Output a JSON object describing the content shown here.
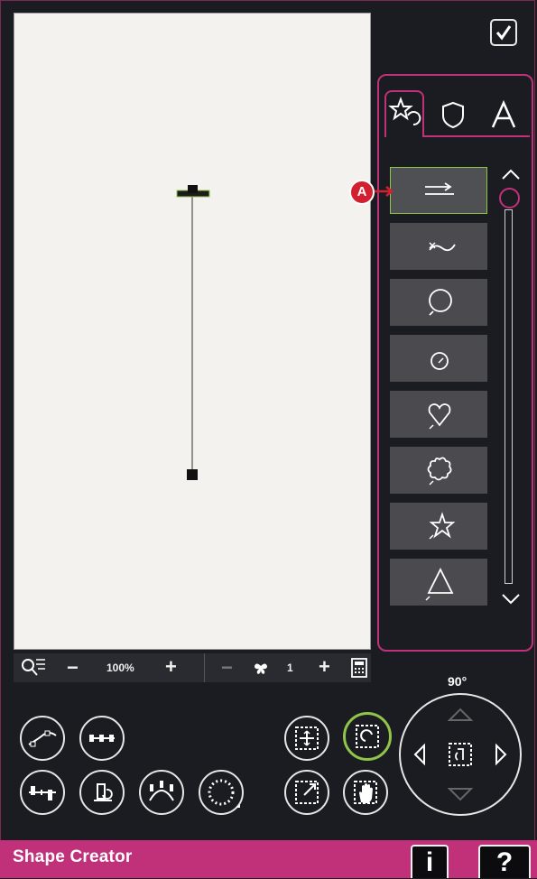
{
  "app_title": "Shape Creator",
  "confirm": {
    "icon": "checkmark-icon"
  },
  "tabs": [
    {
      "name": "shapes",
      "icon": "star-shapes-icon",
      "selected": true
    },
    {
      "name": "outline",
      "icon": "shield-icon",
      "selected": false
    },
    {
      "name": "text",
      "icon": "letter-a-icon",
      "label": "A",
      "selected": false
    }
  ],
  "shape_list": [
    {
      "icon": "straight-line-icon",
      "selected": true
    },
    {
      "icon": "wave-line-icon",
      "selected": false
    },
    {
      "icon": "circle-shape-icon",
      "selected": false
    },
    {
      "icon": "small-circle-shape-icon",
      "selected": false
    },
    {
      "icon": "heart-shape-icon",
      "selected": false
    },
    {
      "icon": "flower-shape-icon",
      "selected": false
    },
    {
      "icon": "star-shape-icon",
      "selected": false
    },
    {
      "icon": "triangle-shape-icon",
      "selected": false
    }
  ],
  "callout_label": "A",
  "zoom": {
    "value": "100%",
    "minus": "−",
    "plus": "+"
  },
  "repeat": {
    "count": "1",
    "minus": "−",
    "plus": "+"
  },
  "angle": "90°",
  "colors": {
    "accent": "#c0317a",
    "selected": "#8fc64a",
    "background": "#1b1c21",
    "callout": "#d22030"
  },
  "help": {
    "info": "i",
    "question": "?"
  }
}
